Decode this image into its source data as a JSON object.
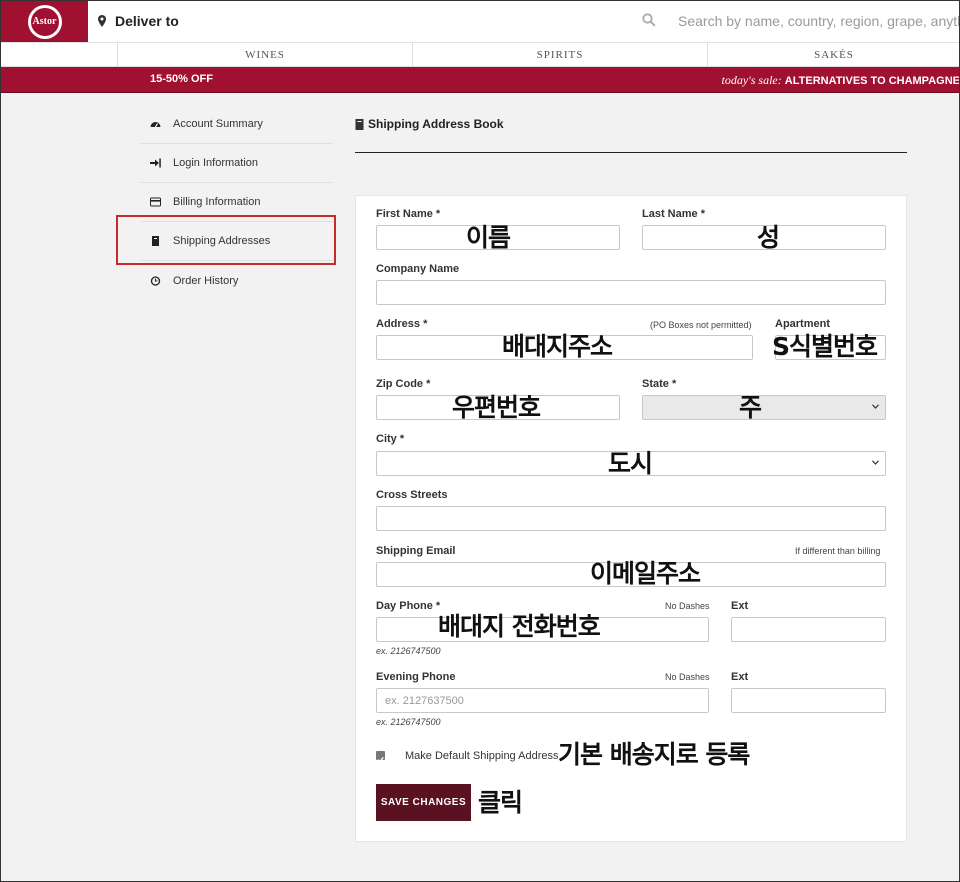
{
  "header": {
    "logo_text": "Astor",
    "deliver_label": "Deliver to",
    "search_placeholder": "Search by name, country, region, grape, anything"
  },
  "categories": [
    "WINES",
    "SPIRITS",
    "SAKÉS"
  ],
  "promo": {
    "left": "15-50% OFF",
    "right_prefix": "today's sale:",
    "right_text": "ALTERNATIVES TO CHAMPAGNE"
  },
  "sidebar": {
    "items": [
      {
        "label": "Account Summary",
        "icon": "dashboard-icon"
      },
      {
        "label": "Login Information",
        "icon": "sign-in-icon"
      },
      {
        "label": "Billing Information",
        "icon": "credit-card-icon"
      },
      {
        "label": "Shipping Addresses",
        "icon": "book-icon",
        "selected": true
      },
      {
        "label": "Order History",
        "icon": "clock-icon"
      }
    ]
  },
  "main": {
    "title": "Shipping Address Book",
    "title_icon": "book-icon"
  },
  "form": {
    "first_name_label": "First Name *",
    "last_name_label": "Last Name *",
    "company_label": "Company Name",
    "address_label": "Address *",
    "address_hint": "(PO Boxes not permitted)",
    "apartment_label": "Apartment",
    "zip_label": "Zip Code *",
    "state_label": "State *",
    "city_label": "City *",
    "cross_streets_label": "Cross Streets",
    "email_label": "Shipping Email",
    "email_hint": "If different than billing",
    "day_phone_label": "Day Phone *",
    "day_phone_hint": "No Dashes",
    "day_ext_label": "Ext",
    "day_phone_example": "ex. 2126747500",
    "evening_phone_label": "Evening Phone",
    "evening_phone_hint": "No Dashes",
    "evening_ext_label": "Ext",
    "evening_phone_placeholder": "ex. 2127637500",
    "evening_phone_example": "ex. 2126747500",
    "default_checkbox_label": "Make Default Shipping Address",
    "default_checked": true,
    "save_label": "SAVE CHANGES"
  },
  "annotations": {
    "first_name": "이름",
    "last_name": "성",
    "address": "배대지주소",
    "apartment": "S식별번호",
    "zip": "우편번호",
    "state": "주",
    "city": "도시",
    "email": "이메일주소",
    "day_phone": "배대지 전화번호",
    "default": "기본 배송지로 등록",
    "save": "클릭"
  },
  "colors": {
    "brand": "#a01030",
    "button": "#5a1220",
    "highlight_box": "#c62a2a"
  }
}
